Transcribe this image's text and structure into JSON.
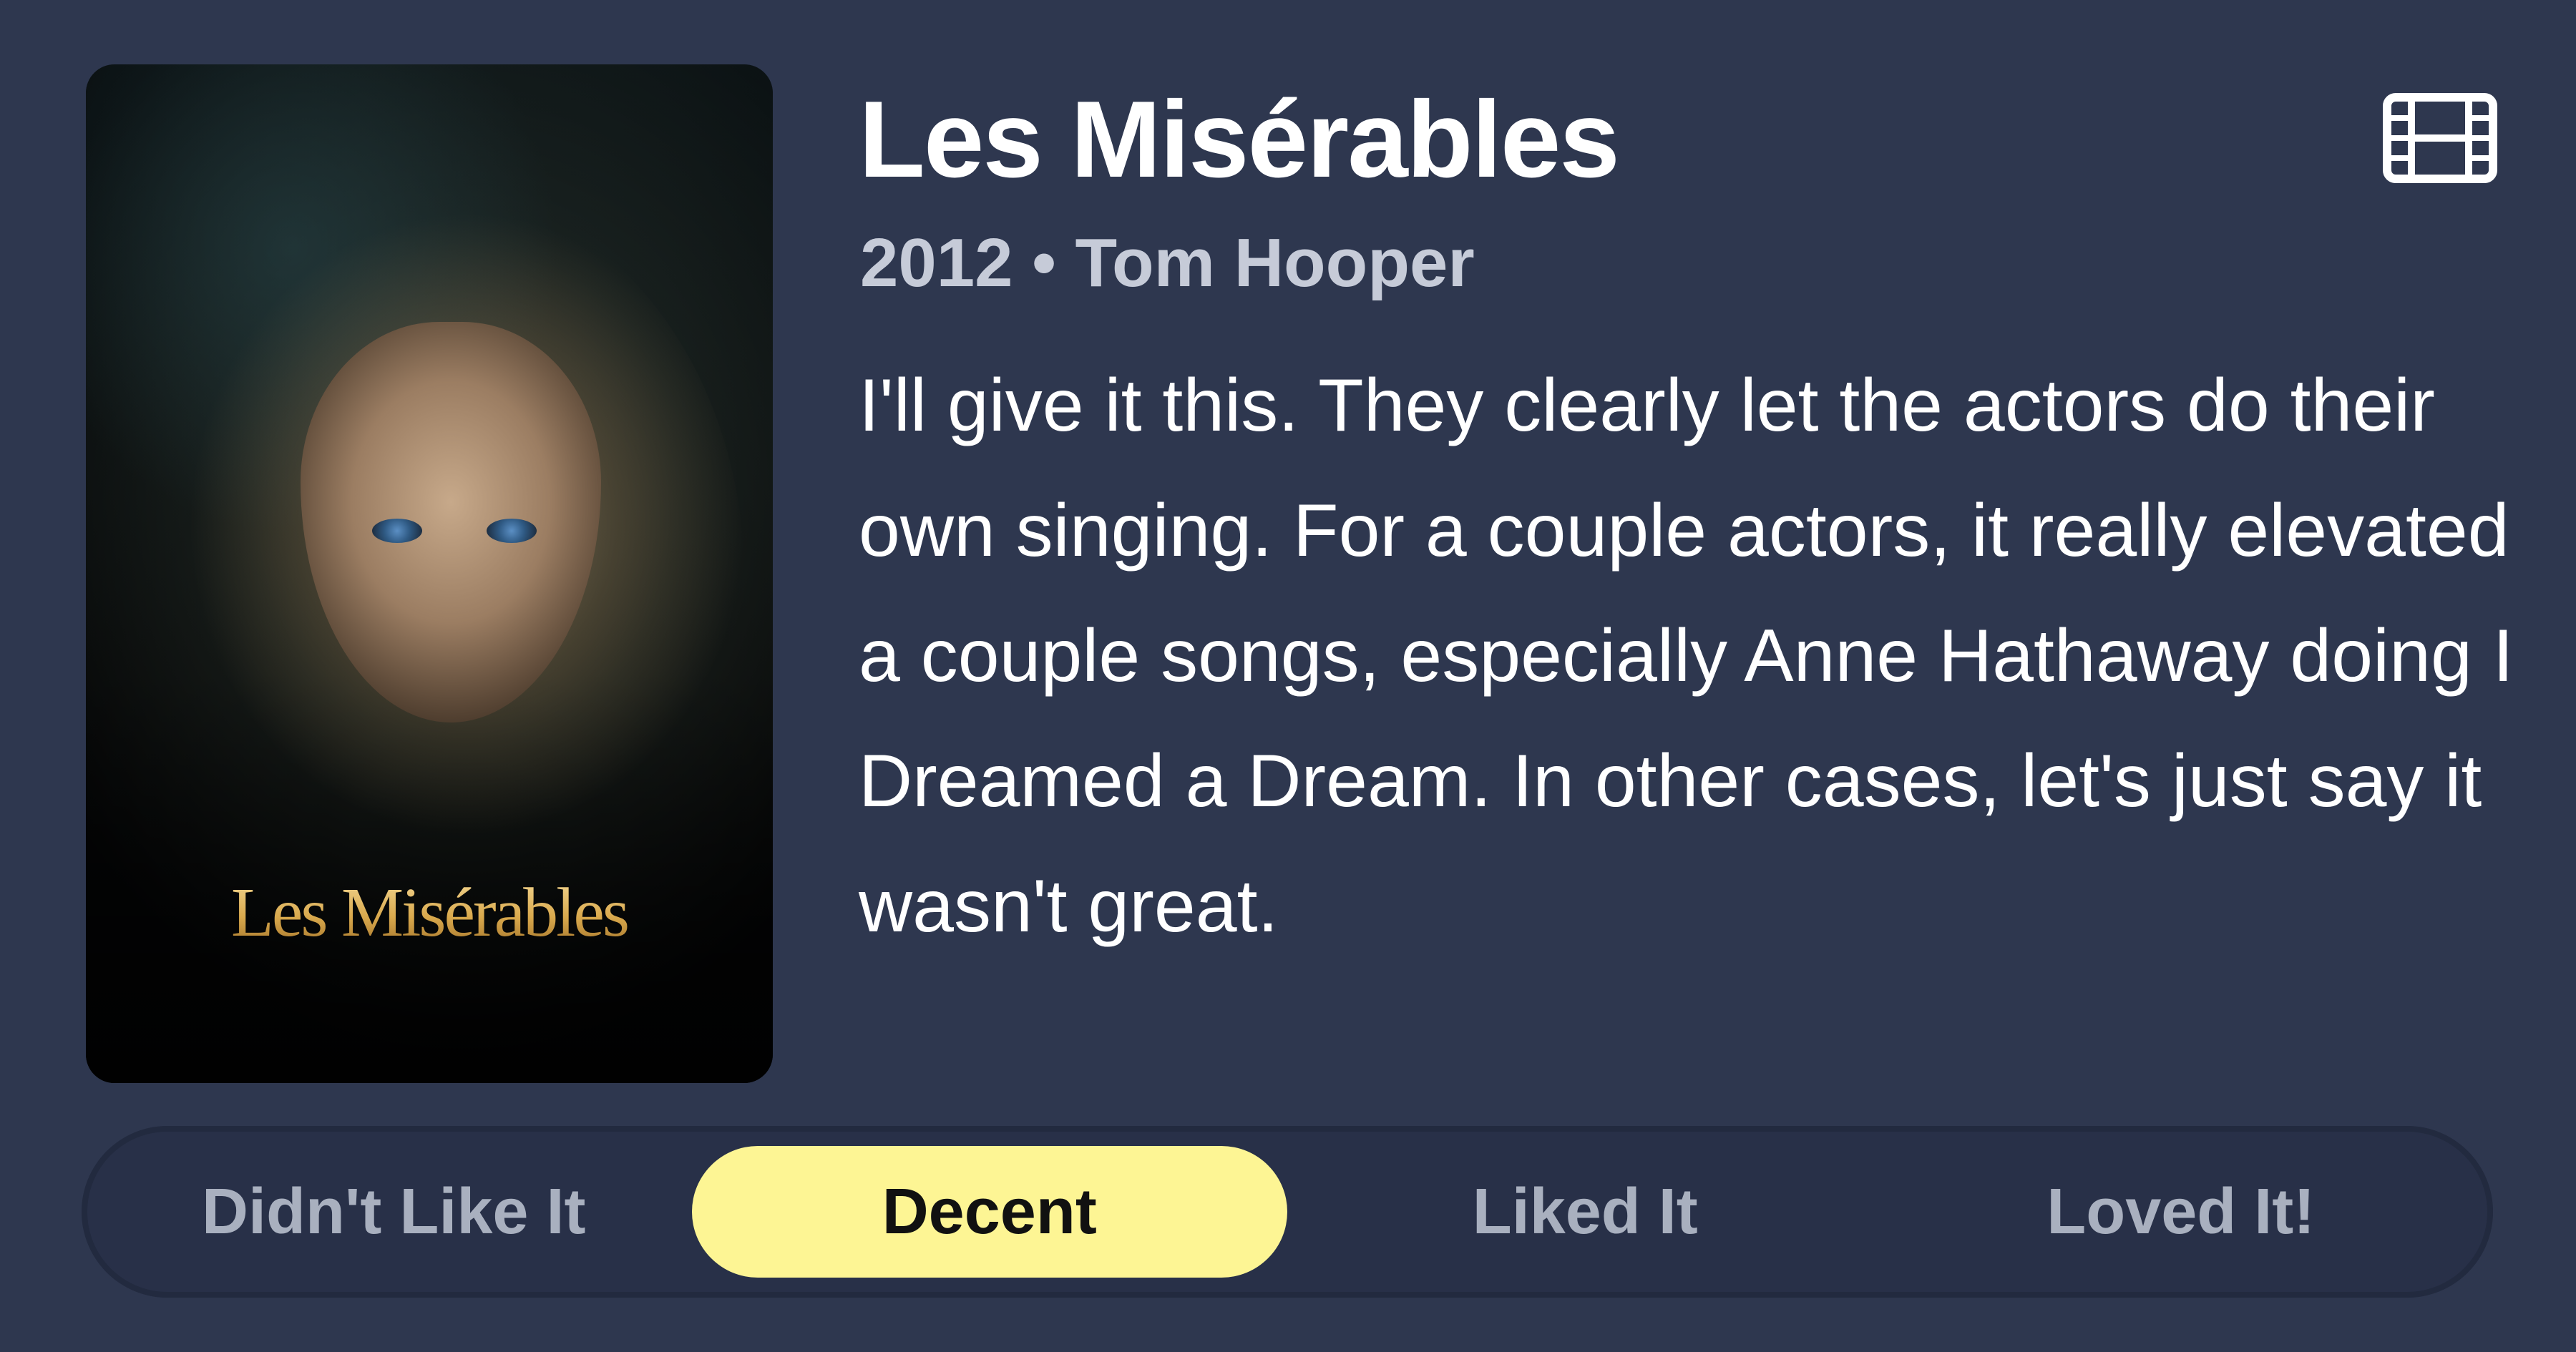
{
  "movie": {
    "title": "Les Misérables",
    "meta": "2012 • Tom Hooper",
    "poster_title": "Les Misérables",
    "type_icon": "film-icon",
    "review": "I'll give it this. They clearly let the actors do their own singing. For a couple actors, it really elevated a couple songs, especially Anne Hathaway doing I Dreamed a Dream. In other cases, let's just say it wasn't great."
  },
  "rating": {
    "options": [
      {
        "label": "Didn't Like It",
        "selected": false
      },
      {
        "label": "Decent",
        "selected": true
      },
      {
        "label": "Liked It",
        "selected": false
      },
      {
        "label": "Loved It!",
        "selected": false
      }
    ]
  },
  "colors": {
    "background": "#2e374f",
    "selected_pill": "#fdf594",
    "muted_text": "#a9b0bf",
    "meta_text": "#c6cbd8"
  }
}
